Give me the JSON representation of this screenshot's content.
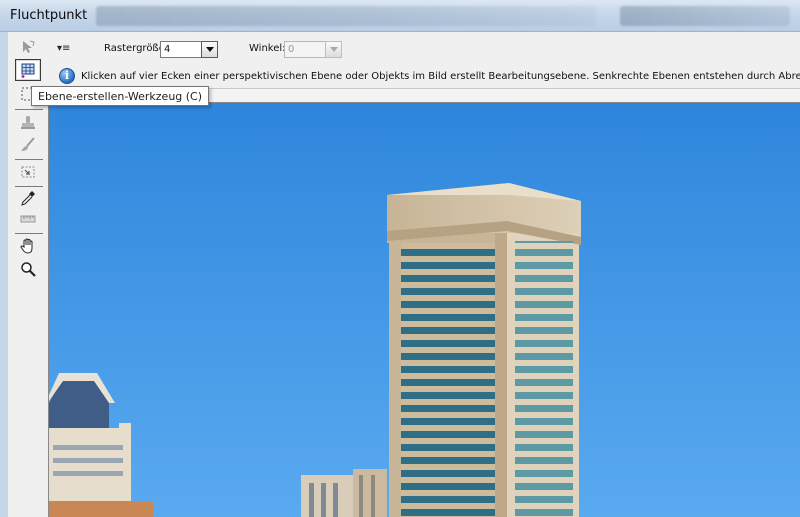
{
  "window": {
    "title": "Fluchtpunkt"
  },
  "toolbar": {
    "tools": [
      {
        "name": "edit-plane-tool",
        "icon": "arrow-plane-icon"
      },
      {
        "name": "create-plane-tool",
        "icon": "create-plane-icon",
        "selected": true
      },
      {
        "name": "marquee-tool",
        "icon": "marquee-icon"
      },
      {
        "name": "stamp-tool",
        "icon": "stamp-icon"
      },
      {
        "name": "brush-tool",
        "icon": "brush-icon"
      },
      {
        "name": "transform-tool",
        "icon": "transform-icon"
      },
      {
        "name": "eyedropper-tool",
        "icon": "eyedropper-icon"
      },
      {
        "name": "measure-tool",
        "icon": "ruler-icon"
      },
      {
        "name": "hand-tool",
        "icon": "hand-icon"
      },
      {
        "name": "zoom-tool",
        "icon": "magnifier-icon"
      }
    ]
  },
  "options": {
    "flyout_icon": "▾≡",
    "grid_size_label": "Rastergröße:",
    "grid_size_value": "4",
    "angle_label": "Winkel:",
    "angle_value": "0"
  },
  "info": {
    "icon": "info-icon",
    "text": "Klicken auf vier Ecken einer perspektivischen Ebene oder Objekts im Bild erstellt Bearbeitungsebene. Senkrechte Ebenen entstehen durch Abreißen von Dehnungsknoten vorh"
  },
  "tooltip": {
    "text": "Ebene-erstellen-Werkzeug (C)"
  },
  "colors": {
    "sky_top": "#2e86dc",
    "sky_bottom": "#5aaaf0",
    "building": "#d2bfa2",
    "window_glass": "#2f6f86"
  }
}
